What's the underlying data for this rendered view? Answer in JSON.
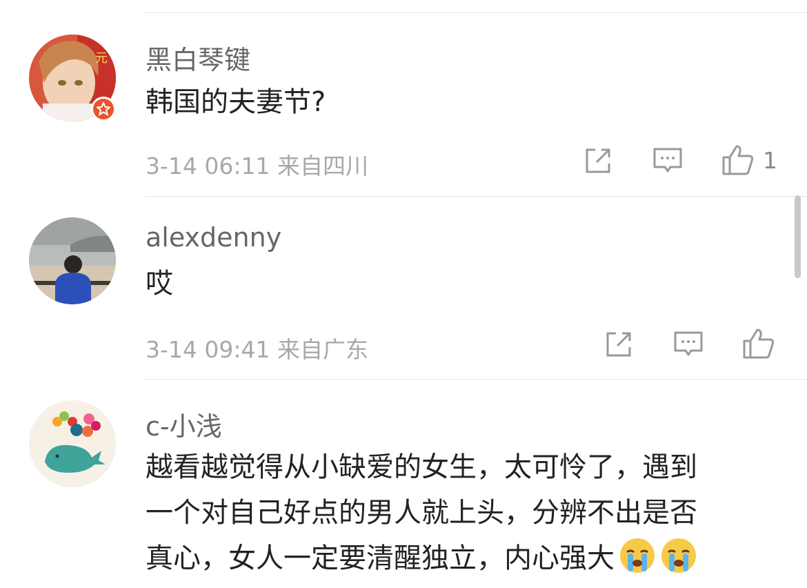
{
  "comments": [
    {
      "username": "黑白琴键",
      "text": "韩国的夫妻节?",
      "date": "3-14",
      "time": "06:11",
      "location": "来自四川",
      "likes": "1",
      "verified_badge": "star-badge-icon"
    },
    {
      "username": "alexdenny",
      "text": "哎",
      "date": "3-14",
      "time": "09:41",
      "location": "来自广东",
      "likes": ""
    },
    {
      "username": "c-小浅",
      "lines": [
        "越看越觉得从小缺爱的女生，太可怜了，遇到",
        "一个对自己好点的男人就上头，分辨不出是否",
        "真心，女人一定要清醒独立，内心强大"
      ],
      "emojis": [
        "crying-face-icon",
        "crying-face-icon"
      ]
    }
  ],
  "colors": {
    "username": "#666666",
    "meta": "#a8a8a8",
    "badge": "#e8542b",
    "divider": "#e6e6e6"
  }
}
